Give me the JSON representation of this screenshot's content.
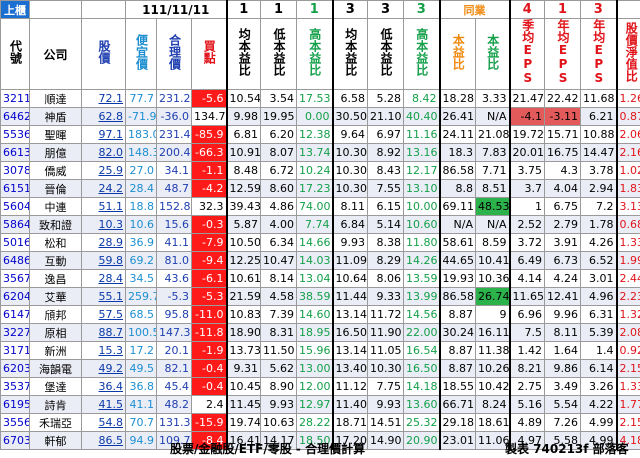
{
  "title_date": "111/11/11",
  "market_tag": "上櫃",
  "group_tag": "同業",
  "column_numbers": [
    "1",
    "1",
    "1",
    "3",
    "3",
    "3",
    "4",
    "1",
    "3"
  ],
  "headers": {
    "code": "代號",
    "company": "公司",
    "price": "股價",
    "cheap": "便宜價",
    "fair": "合理價",
    "buysell": "買點",
    "pe1": "均本益比",
    "pe_low": "低本益比",
    "pe_high": "高本益比",
    "pe3": "均本益比",
    "pe3_low": "低本益比",
    "pe3_high": "高本益比",
    "peer_pe": "本益比",
    "peer_pe2": "本益比",
    "eps_q": "季均EPS",
    "eps_y": "年均EPS",
    "eps_y3": "年均EPS",
    "pb": "股價淨值比"
  },
  "rows": [
    {
      "code": "3211",
      "name": "順達",
      "price": "72.1",
      "cheap": "77.7",
      "fair": "231.2",
      "bs": "-5.6",
      "a": "10.54",
      "b": "3.54",
      "c": "17.53",
      "d": "6.58",
      "e": "5.28",
      "f": "8.42",
      "g": "18.28",
      "h": "3.33",
      "i": "21.47",
      "j": "22.42",
      "k": "11.68",
      "l": "1.26"
    },
    {
      "code": "6462",
      "name": "神盾",
      "price": "62.8",
      "cheap": "-71.9",
      "fair": "-36.0",
      "bs": "134.7",
      "a": "9.98",
      "b": "19.95",
      "c": "0.00",
      "d": "30.50",
      "e": "21.10",
      "f": "40.40",
      "g": "26.41",
      "h": "N/A",
      "i": "-4.1",
      "j": "-3.11",
      "k": "6.21",
      "l": "0.87"
    },
    {
      "code": "5536",
      "name": "聖暉",
      "price": "97.1",
      "cheap": "183.0",
      "fair": "231.4",
      "bs": "-85.9",
      "a": "6.81",
      "b": "6.20",
      "c": "12.38",
      "d": "9.64",
      "e": "6.97",
      "f": "11.16",
      "g": "24.11",
      "h": "21.08",
      "i": "19.72",
      "j": "15.71",
      "k": "10.88",
      "l": "2.06"
    },
    {
      "code": "6613",
      "name": "朋億",
      "price": "82.0",
      "cheap": "148.3",
      "fair": "200.4",
      "bs": "-66.3",
      "a": "10.91",
      "b": "8.07",
      "c": "13.74",
      "d": "10.30",
      "e": "8.92",
      "f": "13.16",
      "g": "18.3",
      "h": "7.83",
      "i": "20.01",
      "j": "16.75",
      "k": "14.47",
      "l": "2.16"
    },
    {
      "code": "3078",
      "name": "僑威",
      "price": "25.9",
      "cheap": "27.0",
      "fair": "34.1",
      "bs": "-1.1",
      "a": "8.48",
      "b": "6.72",
      "c": "10.24",
      "d": "10.30",
      "e": "8.43",
      "f": "12.17",
      "g": "86.58",
      "h": "7.71",
      "i": "3.75",
      "j": "4.3",
      "k": "3.78",
      "l": "1.02"
    },
    {
      "code": "6151",
      "name": "晉倫",
      "price": "24.2",
      "cheap": "28.4",
      "fair": "48.7",
      "bs": "-4.2",
      "a": "12.59",
      "b": "8.60",
      "c": "17.23",
      "d": "10.30",
      "e": "7.55",
      "f": "13.10",
      "g": "8.8",
      "h": "8.51",
      "i": "3.7",
      "j": "4.04",
      "k": "2.94",
      "l": "1.83"
    },
    {
      "code": "5604",
      "name": "中連",
      "price": "51.1",
      "cheap": "18.8",
      "fair": "152.8",
      "bs": "32.3",
      "a": "39.43",
      "b": "4.86",
      "c": "74.00",
      "d": "8.11",
      "e": "6.15",
      "f": "10.00",
      "g": "69.11",
      "h": "48.53",
      "i": "1",
      "j": "6.75",
      "k": "7.2",
      "l": "3.13"
    },
    {
      "code": "5864",
      "name": "致和證",
      "price": "10.3",
      "cheap": "10.6",
      "fair": "15.6",
      "bs": "-0.3",
      "a": "5.87",
      "b": "4.00",
      "c": "7.74",
      "d": "6.84",
      "e": "5.14",
      "f": "10.60",
      "g": "N/A",
      "h": "N/A",
      "i": "2.52",
      "j": "2.79",
      "k": "1.78",
      "l": "0.68"
    },
    {
      "code": "5016",
      "name": "松和",
      "price": "28.9",
      "cheap": "36.9",
      "fair": "41.1",
      "bs": "-7.9",
      "a": "10.50",
      "b": "6.34",
      "c": "14.66",
      "d": "9.93",
      "e": "8.38",
      "f": "11.80",
      "g": "58.61",
      "h": "8.59",
      "i": "3.72",
      "j": "3.91",
      "k": "4.26",
      "l": "1.33"
    },
    {
      "code": "6486",
      "name": "互動",
      "price": "59.8",
      "cheap": "69.2",
      "fair": "81.0",
      "bs": "-9.4",
      "a": "12.25",
      "b": "10.47",
      "c": "14.03",
      "d": "11.09",
      "e": "8.29",
      "f": "14.26",
      "g": "44.65",
      "h": "10.41",
      "i": "6.49",
      "j": "6.73",
      "k": "6.52",
      "l": "1.99"
    },
    {
      "code": "3567",
      "name": "逸昌",
      "price": "28.4",
      "cheap": "34.5",
      "fair": "43.6",
      "bs": "-6.1",
      "a": "10.61",
      "b": "8.14",
      "c": "13.04",
      "d": "10.64",
      "e": "8.06",
      "f": "13.59",
      "g": "19.93",
      "h": "10.36",
      "i": "4.14",
      "j": "4.24",
      "k": "3.01",
      "l": "2.44"
    },
    {
      "code": "6204",
      "name": "艾華",
      "price": "55.1",
      "cheap": "259.7",
      "fair": "-5.3",
      "bs": "-5.3",
      "a": "21.59",
      "b": "4.58",
      "c": "38.59",
      "d": "11.44",
      "e": "9.33",
      "f": "13.99",
      "g": "86.58",
      "h": "26.74",
      "i": "11.65",
      "j": "12.41",
      "k": "4.96",
      "l": "2.23"
    },
    {
      "code": "6147",
      "name": "頎邦",
      "price": "57.5",
      "cheap": "68.5",
      "fair": "95.8",
      "bs": "-11.0",
      "a": "10.83",
      "b": "7.39",
      "c": "14.60",
      "d": "13.14",
      "e": "11.72",
      "f": "14.56",
      "g": "8.87",
      "h": "9",
      "i": "6.96",
      "j": "9.96",
      "k": "6.31",
      "l": "1.32"
    },
    {
      "code": "3227",
      "name": "原相",
      "price": "88.7",
      "cheap": "100.5",
      "fair": "147.3",
      "bs": "-11.8",
      "a": "18.90",
      "b": "8.31",
      "c": "18.95",
      "d": "16.50",
      "e": "11.90",
      "f": "22.00",
      "g": "30.24",
      "h": "16.11",
      "i": "7.5",
      "j": "8.11",
      "k": "5.39",
      "l": "2.08"
    },
    {
      "code": "3171",
      "name": "新洲",
      "price": "15.3",
      "cheap": "17.2",
      "fair": "20.1",
      "bs": "-1.9",
      "a": "13.73",
      "b": "11.50",
      "c": "15.96",
      "d": "13.14",
      "e": "11.05",
      "f": "16.54",
      "g": "8.87",
      "h": "11.38",
      "i": "1.42",
      "j": "1.64",
      "k": "1.4",
      "l": "0.92"
    },
    {
      "code": "6203",
      "name": "海韻電",
      "price": "49.2",
      "cheap": "49.5",
      "fair": "82.1",
      "bs": "-0.4",
      "a": "9.31",
      "b": "5.62",
      "c": "13.00",
      "d": "13.40",
      "e": "10.30",
      "f": "16.50",
      "g": "8.87",
      "h": "10.26",
      "i": "8.21",
      "j": "9.86",
      "k": "6.14",
      "l": "2.15"
    },
    {
      "code": "3537",
      "name": "堡達",
      "price": "36.4",
      "cheap": "36.8",
      "fair": "45.4",
      "bs": "-0.4",
      "a": "10.45",
      "b": "8.90",
      "c": "12.00",
      "d": "11.12",
      "e": "7.75",
      "f": "14.18",
      "g": "18.55",
      "h": "10.42",
      "i": "2.75",
      "j": "3.49",
      "k": "3.26",
      "l": "1.33"
    },
    {
      "code": "6195",
      "name": "詩肯",
      "price": "41.5",
      "cheap": "41.1",
      "fair": "48.2",
      "bs": "2.4",
      "a": "11.45",
      "b": "9.93",
      "c": "12.97",
      "d": "11.40",
      "e": "9.93",
      "f": "13.60",
      "g": "66.71",
      "h": "8.24",
      "i": "5.16",
      "j": "5.54",
      "k": "4.22",
      "l": "1.77"
    },
    {
      "code": "3556",
      "name": "禾瑞亞",
      "price": "54.8",
      "cheap": "70.7",
      "fair": "131.3",
      "bs": "-15.9",
      "a": "19.74",
      "b": "10.63",
      "c": "28.22",
      "d": "18.71",
      "e": "14.51",
      "f": "25.32",
      "g": "29.18",
      "h": "18.61",
      "i": "4.89",
      "j": "7.26",
      "k": "4.99",
      "l": "2.15"
    },
    {
      "code": "6703",
      "name": "軒郁",
      "price": "86.5",
      "cheap": "94.9",
      "fair": "109.7",
      "bs": "-8.4",
      "a": "16.41",
      "b": "14.17",
      "c": "18.50",
      "d": "17.20",
      "e": "14.90",
      "f": "20.90",
      "g": "23.01",
      "h": "11.06",
      "i": "4.97",
      "j": "5.58",
      "k": "4.99",
      "l": "4.18"
    }
  ],
  "footer_left": "股票/金融股/ETF/零股 - 合理價計算",
  "footer_right": "製表 740213f 部落客"
}
